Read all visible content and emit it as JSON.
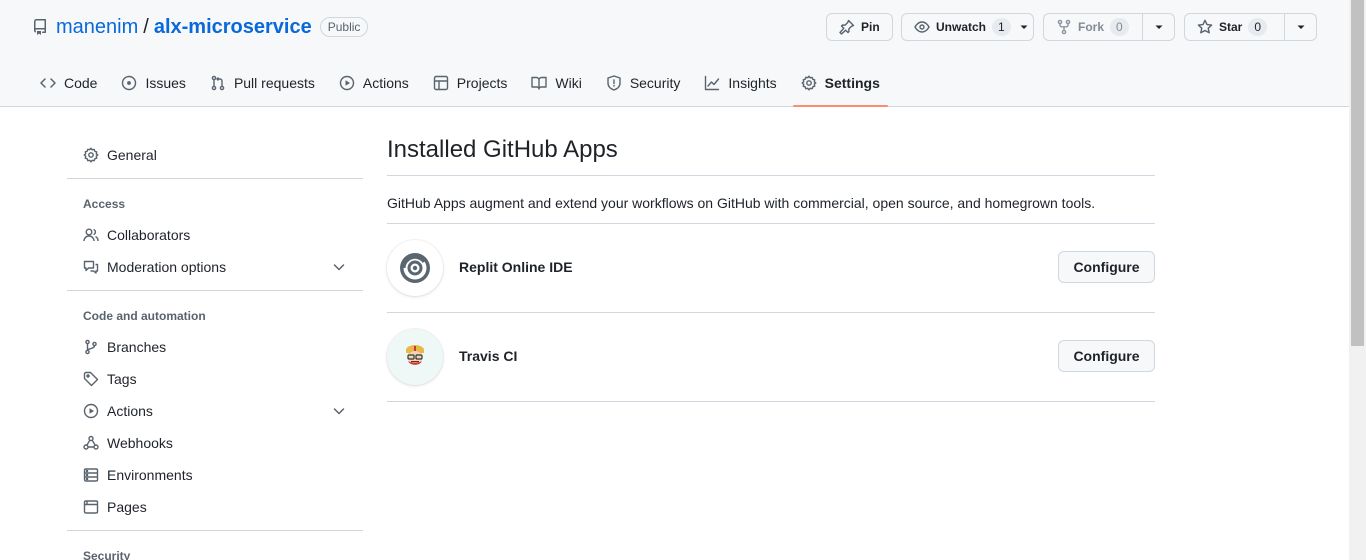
{
  "repo": {
    "owner": "manenim",
    "separator": "/",
    "name": "alx-microservice",
    "visibility": "Public"
  },
  "actions": {
    "pin": "Pin",
    "watch": "Unwatch",
    "watch_count": "1",
    "fork": "Fork",
    "fork_count": "0",
    "star": "Star",
    "star_count": "0"
  },
  "tabs": [
    {
      "label": "Code",
      "icon": "code-icon"
    },
    {
      "label": "Issues",
      "icon": "issue-icon"
    },
    {
      "label": "Pull requests",
      "icon": "pull-request-icon"
    },
    {
      "label": "Actions",
      "icon": "play-icon"
    },
    {
      "label": "Projects",
      "icon": "table-icon"
    },
    {
      "label": "Wiki",
      "icon": "book-icon"
    },
    {
      "label": "Security",
      "icon": "shield-icon"
    },
    {
      "label": "Insights",
      "icon": "graph-icon"
    },
    {
      "label": "Settings",
      "icon": "gear-icon",
      "active": true
    }
  ],
  "sidebar": {
    "general": "General",
    "access_heading": "Access",
    "collaborators": "Collaborators",
    "moderation": "Moderation options",
    "code_heading": "Code and automation",
    "branches": "Branches",
    "tags": "Tags",
    "actions": "Actions",
    "webhooks": "Webhooks",
    "environments": "Environments",
    "pages": "Pages",
    "security_heading": "Security"
  },
  "main": {
    "title": "Installed GitHub Apps",
    "description": "GitHub Apps augment and extend your workflows on GitHub with commercial, open source, and homegrown tools.",
    "apps": [
      {
        "name": "Replit Online IDE",
        "button": "Configure"
      },
      {
        "name": "Travis CI",
        "button": "Configure"
      }
    ]
  },
  "colors": {
    "link": "#0969da",
    "active_tab_underline": "#fd8c73",
    "border": "#d0d7de",
    "header_bg": "#f6f8fa"
  }
}
